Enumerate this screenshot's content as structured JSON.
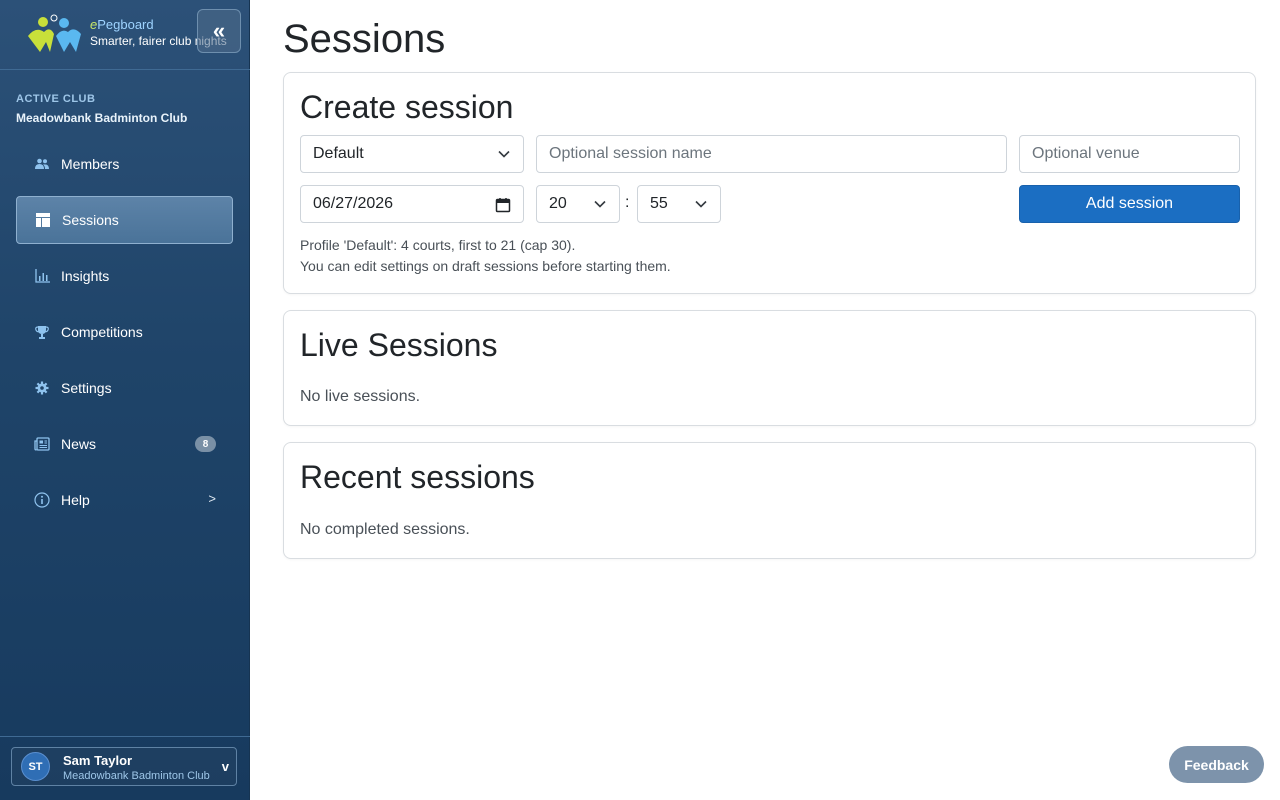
{
  "brand": {
    "prefix": "e",
    "name": "Pegboard",
    "tagline": "Smarter, fairer club nights",
    "collapse_icon": "«"
  },
  "sidebar": {
    "active_club_label": "ACTIVE CLUB",
    "active_club_name": "Meadowbank Badminton Club",
    "items": [
      {
        "label": "Members",
        "icon": "members-icon",
        "active": false
      },
      {
        "label": "Sessions",
        "icon": "sessions-icon",
        "active": true
      },
      {
        "label": "Insights",
        "icon": "insights-icon",
        "active": false
      },
      {
        "label": "Competitions",
        "icon": "trophy-icon",
        "active": false
      },
      {
        "label": "Settings",
        "icon": "gear-icon",
        "active": false
      },
      {
        "label": "News",
        "icon": "news-icon",
        "active": false,
        "badge": "8"
      },
      {
        "label": "Help",
        "icon": "help-icon",
        "active": false,
        "chevron": ">"
      }
    ]
  },
  "user": {
    "initials": "ST",
    "name": "Sam Taylor",
    "club": "Meadowbank Badminton Club",
    "toggle": "v"
  },
  "page": {
    "title": "Sessions"
  },
  "create_session": {
    "heading": "Create session",
    "profile_value": "Default",
    "name_placeholder": "Optional session name",
    "venue_placeholder": "Optional venue",
    "date_value": "06/27/2026",
    "hour_value": "20",
    "time_separator": ":",
    "minute_value": "55",
    "add_button": "Add session",
    "profile_info": "Profile 'Default': 4 courts, first to 21 (cap 30).",
    "edit_info": "You can edit settings on draft sessions before starting them."
  },
  "live_sessions": {
    "heading": "Live Sessions",
    "empty_text": "No live sessions."
  },
  "recent_sessions": {
    "heading": "Recent sessions",
    "empty_text": "No completed sessions."
  },
  "feedback_button": "Feedback",
  "colors": {
    "sidebar_top": "#2c5178",
    "sidebar_bottom": "#173a5e",
    "primary": "#1b6ec2",
    "feedback": "#7d93ab"
  }
}
